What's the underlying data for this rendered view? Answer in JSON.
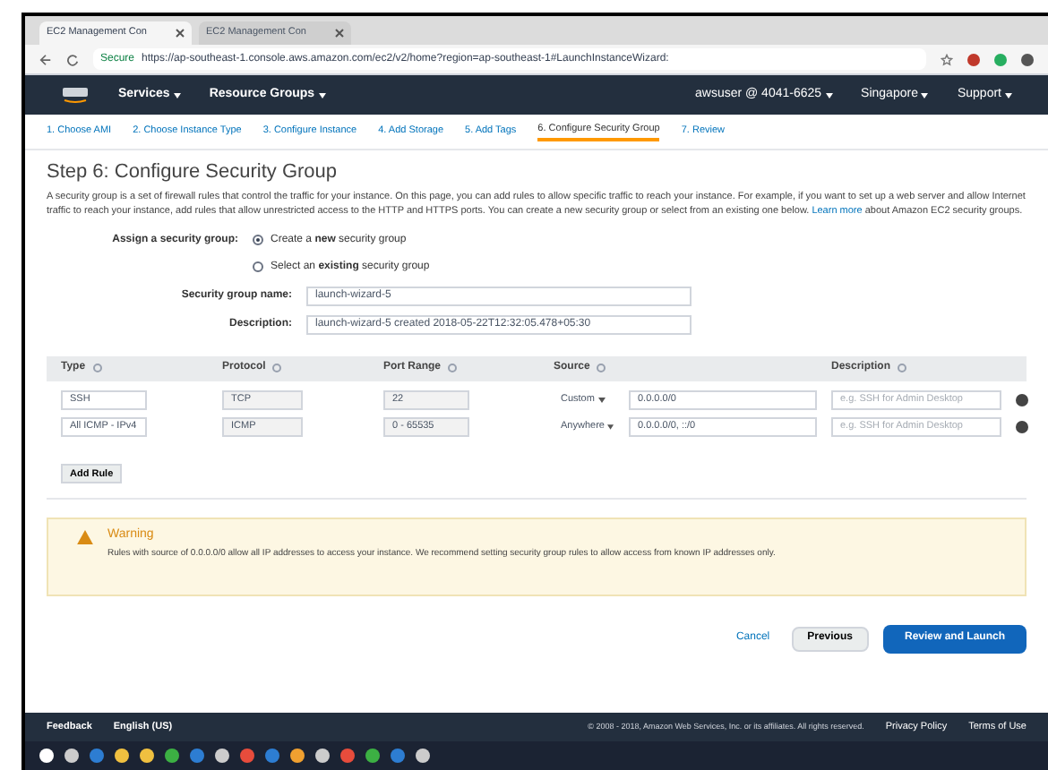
{
  "browser": {
    "tabs": [
      {
        "label": "EC2 Management Con",
        "selected": true
      },
      {
        "label": "EC2 Management Con",
        "selected": false
      }
    ],
    "secure": "Secure",
    "url": "https://ap-southeast-1.console.aws.amazon.com/ec2/v2/home?region=ap-southeast-1#LaunchInstanceWizard:"
  },
  "nav": {
    "items": [
      "Services",
      "Resource Groups"
    ],
    "account": "awsuser @ 4041-6625",
    "region": "Singapore",
    "support": "Support"
  },
  "steps": [
    {
      "label": "1. Choose AMI",
      "selected": false
    },
    {
      "label": "2. Choose Instance Type",
      "selected": false
    },
    {
      "label": "3. Configure Instance",
      "selected": false
    },
    {
      "label": "4. Add Storage",
      "selected": false
    },
    {
      "label": "5. Add Tags",
      "selected": false
    },
    {
      "label": "6. Configure Security Group",
      "selected": true
    },
    {
      "label": "7. Review",
      "selected": false
    }
  ],
  "title": "Step 6: Configure Security Group",
  "intro": {
    "text": "A security group is a set of firewall rules that control the traffic for your instance. On this page, you can add rules to allow specific traffic to reach your instance. For example, if you want to set up a web server and allow Internet traffic to reach your instance, add rules that allow unrestricted access to the HTTP and HTTPS ports. You can create a new security group or select from an existing one below.",
    "link": "Learn more",
    "after": "about Amazon EC2 security groups."
  },
  "assign": {
    "label": "Assign a security group:",
    "options": [
      {
        "label": "Create a **new** security group",
        "selected": true
      },
      {
        "label": "Select an **existing** security group",
        "selected": false
      }
    ]
  },
  "fields": [
    {
      "label": "Security group name:",
      "value": "launch-wizard-5"
    },
    {
      "label": "Description:",
      "value": "launch-wizard-5 created 2018-05-22T12:32:05.478+05:30"
    }
  ],
  "table": {
    "columns": [
      "Type",
      "Protocol",
      "Port Range",
      "Source",
      "Description"
    ],
    "rows": [
      {
        "type": "SSH",
        "protocol": "TCP",
        "port": "22",
        "source": "Custom",
        "cidr": "0.0.0.0/0",
        "placeholder": "e.g. SSH for Admin Desktop"
      },
      {
        "type": "All ICMP - IPv4",
        "protocol": "ICMP",
        "port": "0 - 65535",
        "source": "Anywhere",
        "cidr": "0.0.0.0/0, ::/0",
        "placeholder": "e.g. SSH for Admin Desktop"
      }
    ]
  },
  "add_rule": "Add Rule",
  "warning": {
    "title": "Warning",
    "text": "Rules with source of 0.0.0.0/0 allow all IP addresses to access your instance. We recommend setting security group rules to allow access from known IP addresses only."
  },
  "buttons": [
    {
      "label": "Cancel",
      "kind": "link"
    },
    {
      "label": "Previous",
      "kind": "secondary"
    },
    {
      "label": "Review and Launch",
      "kind": "primary"
    }
  ],
  "footer": {
    "feedback": "Feedback",
    "language": "English (US)",
    "copyright": "© 2008 - 2018, Amazon Web Services, Inc. or its affiliates. All rights reserved.",
    "links": [
      "Privacy Policy",
      "Terms of Use"
    ]
  }
}
